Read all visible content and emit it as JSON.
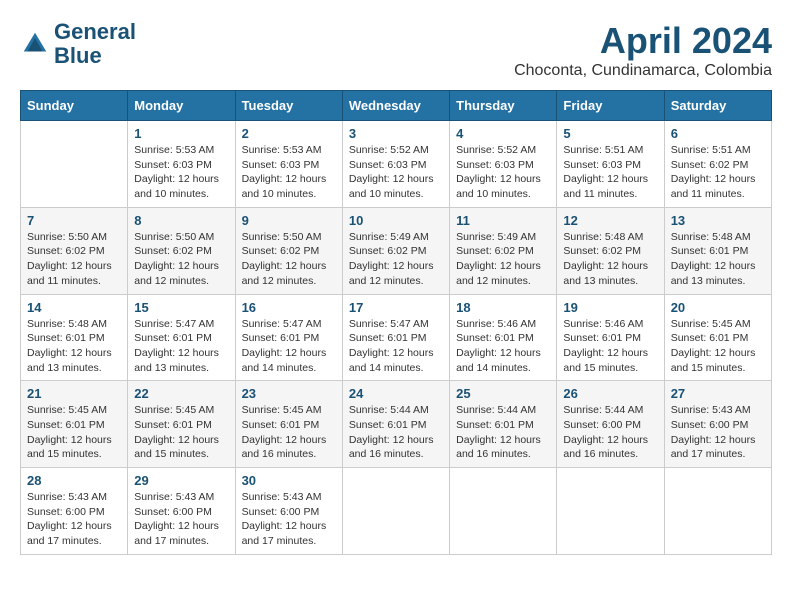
{
  "header": {
    "logo_line1": "General",
    "logo_line2": "Blue",
    "month": "April 2024",
    "location": "Choconta, Cundinamarca, Colombia"
  },
  "days_of_week": [
    "Sunday",
    "Monday",
    "Tuesday",
    "Wednesday",
    "Thursday",
    "Friday",
    "Saturday"
  ],
  "weeks": [
    [
      {
        "num": "",
        "info": ""
      },
      {
        "num": "1",
        "info": "Sunrise: 5:53 AM\nSunset: 6:03 PM\nDaylight: 12 hours\nand 10 minutes."
      },
      {
        "num": "2",
        "info": "Sunrise: 5:53 AM\nSunset: 6:03 PM\nDaylight: 12 hours\nand 10 minutes."
      },
      {
        "num": "3",
        "info": "Sunrise: 5:52 AM\nSunset: 6:03 PM\nDaylight: 12 hours\nand 10 minutes."
      },
      {
        "num": "4",
        "info": "Sunrise: 5:52 AM\nSunset: 6:03 PM\nDaylight: 12 hours\nand 10 minutes."
      },
      {
        "num": "5",
        "info": "Sunrise: 5:51 AM\nSunset: 6:03 PM\nDaylight: 12 hours\nand 11 minutes."
      },
      {
        "num": "6",
        "info": "Sunrise: 5:51 AM\nSunset: 6:02 PM\nDaylight: 12 hours\nand 11 minutes."
      }
    ],
    [
      {
        "num": "7",
        "info": "Sunrise: 5:50 AM\nSunset: 6:02 PM\nDaylight: 12 hours\nand 11 minutes."
      },
      {
        "num": "8",
        "info": "Sunrise: 5:50 AM\nSunset: 6:02 PM\nDaylight: 12 hours\nand 12 minutes."
      },
      {
        "num": "9",
        "info": "Sunrise: 5:50 AM\nSunset: 6:02 PM\nDaylight: 12 hours\nand 12 minutes."
      },
      {
        "num": "10",
        "info": "Sunrise: 5:49 AM\nSunset: 6:02 PM\nDaylight: 12 hours\nand 12 minutes."
      },
      {
        "num": "11",
        "info": "Sunrise: 5:49 AM\nSunset: 6:02 PM\nDaylight: 12 hours\nand 12 minutes."
      },
      {
        "num": "12",
        "info": "Sunrise: 5:48 AM\nSunset: 6:02 PM\nDaylight: 12 hours\nand 13 minutes."
      },
      {
        "num": "13",
        "info": "Sunrise: 5:48 AM\nSunset: 6:01 PM\nDaylight: 12 hours\nand 13 minutes."
      }
    ],
    [
      {
        "num": "14",
        "info": "Sunrise: 5:48 AM\nSunset: 6:01 PM\nDaylight: 12 hours\nand 13 minutes."
      },
      {
        "num": "15",
        "info": "Sunrise: 5:47 AM\nSunset: 6:01 PM\nDaylight: 12 hours\nand 13 minutes."
      },
      {
        "num": "16",
        "info": "Sunrise: 5:47 AM\nSunset: 6:01 PM\nDaylight: 12 hours\nand 14 minutes."
      },
      {
        "num": "17",
        "info": "Sunrise: 5:47 AM\nSunset: 6:01 PM\nDaylight: 12 hours\nand 14 minutes."
      },
      {
        "num": "18",
        "info": "Sunrise: 5:46 AM\nSunset: 6:01 PM\nDaylight: 12 hours\nand 14 minutes."
      },
      {
        "num": "19",
        "info": "Sunrise: 5:46 AM\nSunset: 6:01 PM\nDaylight: 12 hours\nand 15 minutes."
      },
      {
        "num": "20",
        "info": "Sunrise: 5:45 AM\nSunset: 6:01 PM\nDaylight: 12 hours\nand 15 minutes."
      }
    ],
    [
      {
        "num": "21",
        "info": "Sunrise: 5:45 AM\nSunset: 6:01 PM\nDaylight: 12 hours\nand 15 minutes."
      },
      {
        "num": "22",
        "info": "Sunrise: 5:45 AM\nSunset: 6:01 PM\nDaylight: 12 hours\nand 15 minutes."
      },
      {
        "num": "23",
        "info": "Sunrise: 5:45 AM\nSunset: 6:01 PM\nDaylight: 12 hours\nand 16 minutes."
      },
      {
        "num": "24",
        "info": "Sunrise: 5:44 AM\nSunset: 6:01 PM\nDaylight: 12 hours\nand 16 minutes."
      },
      {
        "num": "25",
        "info": "Sunrise: 5:44 AM\nSunset: 6:01 PM\nDaylight: 12 hours\nand 16 minutes."
      },
      {
        "num": "26",
        "info": "Sunrise: 5:44 AM\nSunset: 6:00 PM\nDaylight: 12 hours\nand 16 minutes."
      },
      {
        "num": "27",
        "info": "Sunrise: 5:43 AM\nSunset: 6:00 PM\nDaylight: 12 hours\nand 17 minutes."
      }
    ],
    [
      {
        "num": "28",
        "info": "Sunrise: 5:43 AM\nSunset: 6:00 PM\nDaylight: 12 hours\nand 17 minutes."
      },
      {
        "num": "29",
        "info": "Sunrise: 5:43 AM\nSunset: 6:00 PM\nDaylight: 12 hours\nand 17 minutes."
      },
      {
        "num": "30",
        "info": "Sunrise: 5:43 AM\nSunset: 6:00 PM\nDaylight: 12 hours\nand 17 minutes."
      },
      {
        "num": "",
        "info": ""
      },
      {
        "num": "",
        "info": ""
      },
      {
        "num": "",
        "info": ""
      },
      {
        "num": "",
        "info": ""
      }
    ]
  ]
}
